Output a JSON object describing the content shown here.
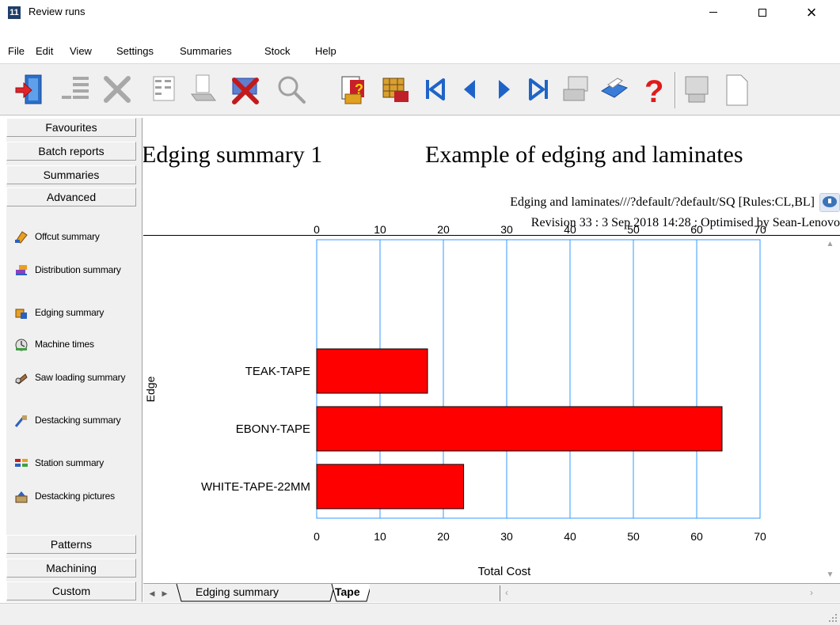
{
  "window": {
    "app_icon_text": "11",
    "title": "Review runs",
    "close_glyph": "×"
  },
  "menu": [
    "File",
    "Edit",
    "View",
    "Settings",
    "Summaries",
    "Stock",
    "Help"
  ],
  "toolbar": {
    "icons": [
      "exit-icon",
      "list-icon",
      "delete-icon",
      "columns-icon",
      "sort-icon",
      "cancel-run-icon",
      "search-icon",
      "report-help-icon",
      "stock-icon",
      "first-icon",
      "previous-icon",
      "next-icon",
      "last-icon",
      "grid-print-icon",
      "print-icon",
      "help-icon",
      "preview-icon",
      "page-icon"
    ]
  },
  "sidebar": {
    "top_tabs": [
      "Favourites",
      "Batch reports",
      "Summaries",
      "Advanced"
    ],
    "items": [
      {
        "label": "Offcut summary",
        "icon": "offcut-icon"
      },
      {
        "label": "Distribution summary",
        "icon": "distribution-icon"
      },
      {
        "label": "Edging summary",
        "icon": "edging-icon"
      },
      {
        "label": "Machine times",
        "icon": "machine-icon"
      },
      {
        "label": "Saw loading summary",
        "icon": "saw-icon"
      },
      {
        "label": "Destacking summary",
        "icon": "destacking-icon"
      },
      {
        "label": "Station summary",
        "icon": "station-icon"
      },
      {
        "label": "Destacking pictures",
        "icon": "destacking-pictures-icon"
      }
    ],
    "bottom_tabs": [
      "Patterns",
      "Machining",
      "Custom"
    ]
  },
  "report": {
    "title_left": "Edging summary 1",
    "title_right": "Example of edging and laminates",
    "subtitle_1": "Edging and laminates///?default/?default/SQ [Rules:CL,BL]",
    "subtitle_2": "Revision 33 : 3 Sep 2018 14:28 : Optimised by Sean-Lenovo"
  },
  "chart_data": {
    "type": "bar",
    "orientation": "horizontal",
    "categories": [
      "TEAK-TAPE",
      "EBONY-TAPE",
      "WHITE-TAPE-22MM"
    ],
    "values": [
      17.5,
      64,
      23.2
    ],
    "xlabel": "Total Cost",
    "ylabel": "Edge",
    "xlim": [
      0,
      70
    ],
    "xticks": [
      0,
      10,
      20,
      30,
      40,
      50,
      60,
      70
    ],
    "bar_color": "#ff0000",
    "grid_color": "#3399ff",
    "grid": true
  },
  "bottom_tabs": {
    "tabs": [
      "Edging summary",
      "Tape"
    ],
    "active": "Tape"
  }
}
